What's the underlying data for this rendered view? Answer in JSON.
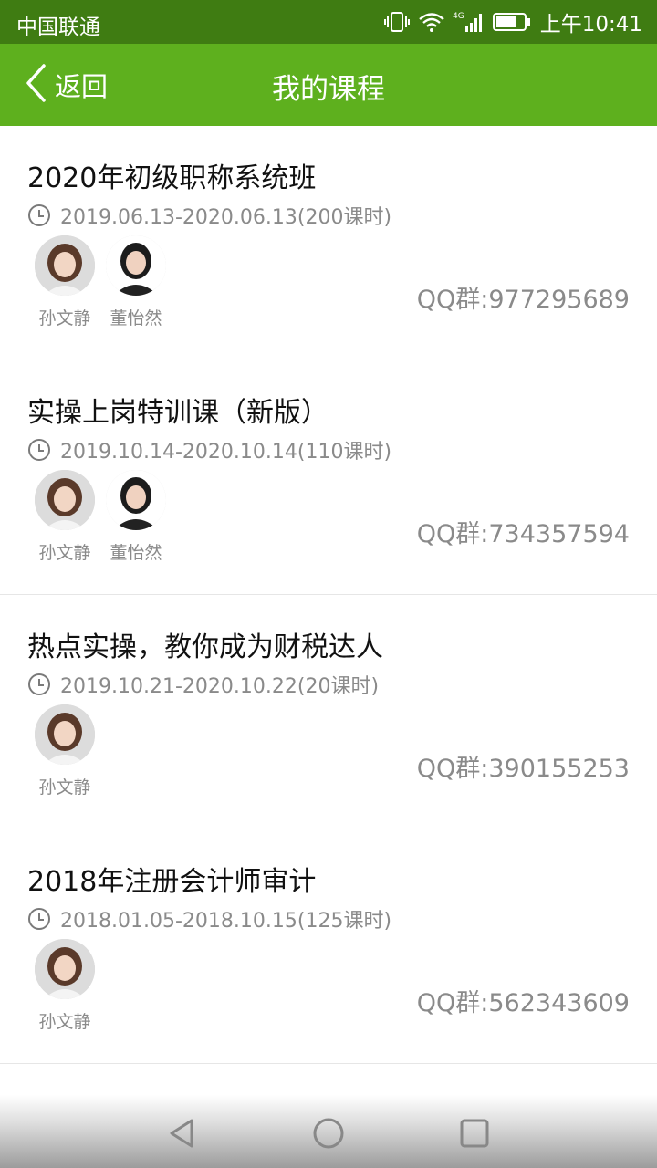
{
  "status_bar": {
    "carrier": "中国联通",
    "time": "上午10:41",
    "icons": [
      "vibrate-icon",
      "wifi-icon",
      "signal-4g-icon",
      "battery-icon"
    ],
    "network_type": "4G"
  },
  "nav": {
    "back_label": "返回",
    "title": "我的课程"
  },
  "colors": {
    "status_bar": "#3f7c12",
    "nav_bar": "#5eb01e",
    "title_text": "#111111",
    "secondary_text": "#8a8a8a"
  },
  "courses": [
    {
      "title": "2020年初级职称系统班",
      "period": "2019.06.13-2020.06.13(200课时)",
      "teachers": [
        "孙文静",
        "董怡然"
      ],
      "qq": "QQ群:977295689"
    },
    {
      "title": "实操上岗特训课（新版）",
      "period": "2019.10.14-2020.10.14(110课时)",
      "teachers": [
        "孙文静",
        "董怡然"
      ],
      "qq": "QQ群:734357594"
    },
    {
      "title": "热点实操，教你成为财税达人",
      "period": "2019.10.21-2020.10.22(20课时)",
      "teachers": [
        "孙文静"
      ],
      "qq": "QQ群:390155253"
    },
    {
      "title": "2018年注册会计师审计",
      "period": "2018.01.05-2018.10.15(125课时)",
      "teachers": [
        "孙文静"
      ],
      "qq": "QQ群:562343609"
    }
  ],
  "system_nav": {
    "icons": [
      "back-triangle-icon",
      "home-circle-icon",
      "recents-square-icon"
    ]
  }
}
